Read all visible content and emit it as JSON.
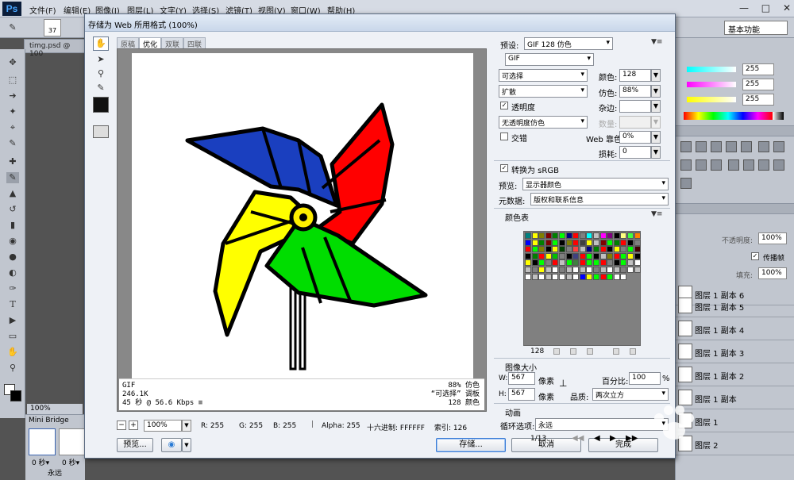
{
  "app": {
    "logo": "Ps",
    "menu": [
      "文件(F)",
      "编辑(E)",
      "图像(I)",
      "图层(L)",
      "文字(Y)",
      "选择(S)",
      "滤镜(T)",
      "视图(V)",
      "窗口(W)",
      "帮助(H)"
    ],
    "workspace": "基本功能",
    "brush_size": "37",
    "doc_tab": "timg.psd @ 100",
    "zoom_status": "100%",
    "mini_bridge_tab": "Mini Bridge",
    "frame_time": "0 秒▾",
    "loop": "永远"
  },
  "right_panel": {
    "color_values": [
      "255",
      "255",
      "255"
    ],
    "opacity_label": "不透明度:",
    "opacity_value": "100%",
    "lock_label": "传播帧",
    "fill_label": "填充:",
    "fill_value": "100%",
    "layers": [
      "图层 1 副本 6",
      "图层 1 副本 5",
      "图层 1 副本 4",
      "图层 1 副本 3",
      "图层 1 副本 2",
      "图层 1 副本",
      "图层 1",
      "图层 2"
    ]
  },
  "dialog": {
    "title": "存储为 Web 所用格式 (100%)",
    "tabs": [
      "原稿",
      "优化",
      "双联",
      "四联"
    ],
    "active_tab": 1,
    "info_left": [
      "GIF",
      "246.1K",
      "45 秒 @ 56.6 Kbps"
    ],
    "info_right": [
      "88% 仿色",
      "“可选择” 调板",
      "128 颜色"
    ],
    "zoom": "100%",
    "pixel_info": {
      "r": "R: 255",
      "g": "G: 255",
      "b": "B: 255",
      "alpha": "Alpha: 255",
      "hex": "十六进制: FFFFFF",
      "index": "索引: 126"
    },
    "buttons": {
      "preview": "预览...",
      "save": "存储...",
      "cancel": "取消",
      "done": "完成"
    },
    "settings": {
      "preset_label": "预设:",
      "preset_value": "GIF 128 仿色",
      "format": "GIF",
      "reduction": "可选择",
      "colors_label": "颜色:",
      "colors_value": "128",
      "dither_algo": "扩散",
      "dither_label": "仿色:",
      "dither_value": "88%",
      "transparency_label": "透明度",
      "matte_label": "杂边:",
      "trans_dither": "无透明度仿色",
      "amount_label": "数量:",
      "interlaced_label": "交错",
      "websnap_label": "Web 靠色:",
      "websnap_value": "0%",
      "lossy_label": "损耗:",
      "lossy_value": "0",
      "srgb_label": "转换为 sRGB",
      "preview_label": "预览:",
      "preview_value": "显示器颜色",
      "metadata_label": "元数据:",
      "metadata_value": "版权和联系信息",
      "color_table_label": "颜色表",
      "color_count": "128",
      "image_size_label": "图像大小",
      "w_label": "W:",
      "w_value": "567",
      "h_label": "H:",
      "h_value": "567",
      "px_unit": "像素",
      "percent_label": "百分比:",
      "percent_value": "100",
      "percent_unit": "%",
      "quality_label": "品质:",
      "quality_value": "两次立方",
      "animation_label": "动画",
      "loop_label": "循环选项:",
      "loop_value": "永远",
      "frame_counter": "1/13"
    }
  },
  "pinwheel": {
    "blade_colors": [
      "#1a3fbf",
      "#ff0000",
      "#ffff00",
      "#00dd00"
    ],
    "hub_color": "#ffee00",
    "outline_color": "#000000"
  },
  "color_table_colors": [
    "#008080",
    "#ffff00",
    "#808000",
    "#800000",
    "#008000",
    "#00ff00",
    "#000080",
    "#ff0000",
    "#808080",
    "#00ffff",
    "#c0c0c0",
    "#ff00ff",
    "#800080",
    "#000000",
    "#ffff80",
    "#40ff40",
    "#ff8000",
    "#0000ff",
    "#ffff00",
    "#008000",
    "#800000",
    "#00ff00",
    "#000000",
    "#808000",
    "#ff0000",
    "#404040",
    "#ffff00",
    "#c0c0c0",
    "#800000",
    "#00ff00",
    "#008000",
    "#ff0000",
    "#000000",
    "#808080",
    "#ff0000",
    "#00ff00",
    "#808000",
    "#000000",
    "#ffff00",
    "#004000",
    "#808080",
    "#ff4040",
    "#c0c0c0",
    "#000080",
    "#008000",
    "#ff0000",
    "#000000",
    "#ffff00",
    "#808080",
    "#00ff00",
    "#400000",
    "#000000",
    "#008000",
    "#ff0000",
    "#ffff00",
    "#00c000",
    "#808080",
    "#000000",
    "#404080",
    "#ff0000",
    "#00ff00",
    "#000000",
    "#c0c0c0",
    "#808000",
    "#ff0000",
    "#00ff00",
    "#ffff00",
    "#000000",
    "#ffff00",
    "#000000",
    "#00ff00",
    "#808080",
    "#ff0000",
    "#c0c0c0",
    "#00ff00",
    "#408040",
    "#ff0000",
    "#00ff00",
    "#00ff00",
    "#ff0000",
    "#808080",
    "#000000",
    "#00ff00",
    "#c0c0c0",
    "#ffffff",
    "#c0c0c0",
    "#808080",
    "#ffff00",
    "#c0c0c0",
    "#ffffff",
    "#808080",
    "#c0c0c0",
    "#ffffff",
    "#c0c0c0",
    "#ffffff",
    "#808080",
    "#c0c0c0",
    "#ffffff",
    "#c0c0c0",
    "#808080",
    "#ffffff",
    "#c0c0c0",
    "#ffffff",
    "#c0c0c0",
    "#ffffff",
    "#c0c0c0",
    "#ffffff",
    "#ffffff",
    "#c0c0c0",
    "#ffffff",
    "#0000ff",
    "#ffff00",
    "#00ff00",
    "#ff0000",
    "#00ff00",
    "#ffffff",
    "#ffffff"
  ]
}
